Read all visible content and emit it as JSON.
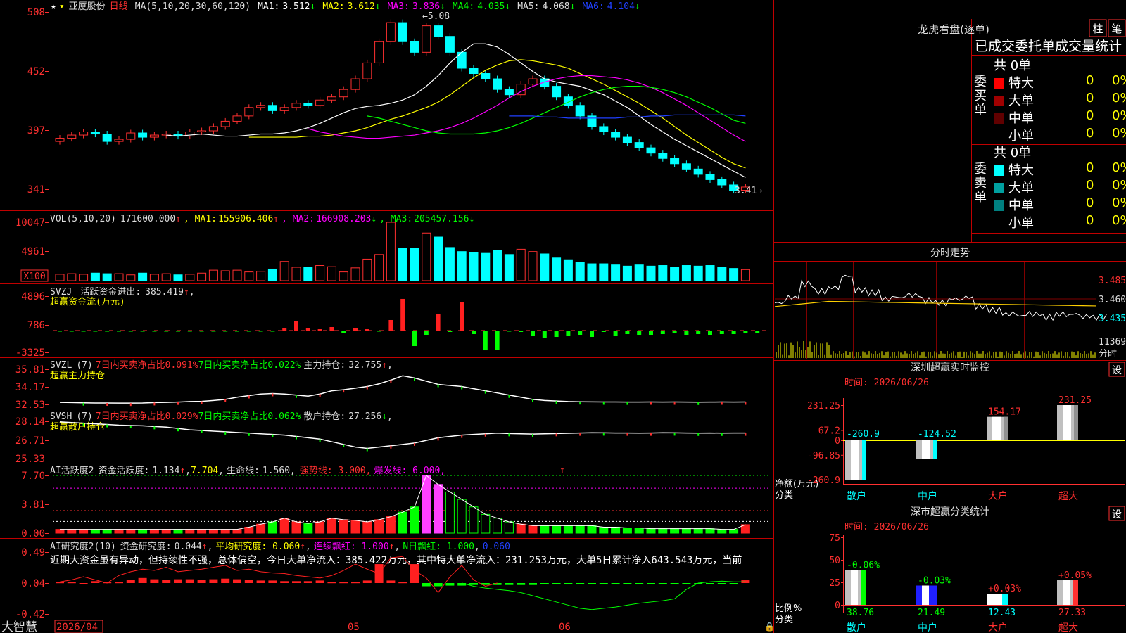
{
  "stock": {
    "name": "亚厦股份",
    "period": "日线"
  },
  "main_panel": {
    "ma_header": "MA(5,10,20,30,60,120)",
    "ma": [
      {
        "label": "MA1:",
        "value": "3.512",
        "arrow": "↓",
        "color": "#ffffff"
      },
      {
        "label": "MA2:",
        "value": "3.612",
        "arrow": "↓",
        "color": "#ffff00"
      },
      {
        "label": "MA3:",
        "value": "3.836",
        "arrow": "↓",
        "color": "#ff00ff"
      },
      {
        "label": "MA4:",
        "value": "4.035",
        "arrow": "↓",
        "color": "#00ff00"
      },
      {
        "label": "MA5:",
        "value": "4.068",
        "arrow": "↓",
        "color": "#dddddd"
      },
      {
        "label": "MA6:",
        "value": "4.104",
        "arrow": "↓",
        "color": "#2040ff"
      }
    ],
    "y_ticks": [
      "508",
      "452",
      "397",
      "341"
    ],
    "high_label": "5.08",
    "low_label": "3.41"
  },
  "vol_panel": {
    "header": "VOL(5,10,20)",
    "value": "171600.000",
    "ma": [
      {
        "label": "MA1:",
        "value": "155906.406",
        "arrow": "↑",
        "color": "#ffff00"
      },
      {
        "label": "MA2:",
        "value": "166908.203",
        "arrow": "↓",
        "color": "#ff00ff"
      },
      {
        "label": "MA3:",
        "value": "205457.156",
        "arrow": "↓",
        "color": "#00ff00"
      }
    ],
    "y_ticks": [
      "10047",
      "4961"
    ],
    "unit": "X100"
  },
  "svzj_panel": {
    "line1_a": "SVZJ",
    "line1_b": "活跃资金进出:",
    "line1_value": "385.419",
    "line1_arrow": "↑",
    "line2": "超赢资金流(万元)",
    "y_ticks": [
      "4896",
      "786",
      "-3325"
    ]
  },
  "svzl_panel": {
    "name": "SVZL",
    "param": "(7)",
    "t1": "7日内买卖净占比0.091%",
    "t2": "7日内买卖净占比0.022%",
    "label": "主力持仓:",
    "value": "32.755",
    "arrow": "↑",
    "line2": "超赢主力持仓",
    "y_ticks": [
      "35.81",
      "34.17",
      "32.53"
    ]
  },
  "svsh_panel": {
    "name": "SVSH",
    "param": "(7)",
    "t1": "7日内买卖净占比0.029%",
    "t2": "7日内买卖净占比0.062%",
    "label": "散户持仓:",
    "value": "27.256",
    "arrow": "↓",
    "line2": "超赢散户持仓",
    "y_ticks": [
      "28.14",
      "26.71",
      "25.33"
    ]
  },
  "ai_active_panel": {
    "title": "AI活跃度2",
    "a_label": "资金活跃度:",
    "a_value": "1.134",
    "a_arrow": "↑",
    "b_value": "7.704",
    "c_label": "生命线:",
    "c_value": "1.560",
    "d_text": "强势线: 3.000",
    "e_text": "爆发线: 6.000",
    "y_ticks": [
      "7.70",
      "3.81",
      "0.00"
    ]
  },
  "ai_research_panel": {
    "title": "AI研究度2(10)",
    "a_label": "资金研究度:",
    "a_value": "0.044",
    "a_arrow": "↑",
    "b_text": "平均研究度: 0.060",
    "b_arrow": "↑",
    "c_text": "连续飘红: 1.000",
    "c_arrow": "↑",
    "d_text": "N日飘红: 1.000",
    "e_text": "0.060",
    "commentary": "近期大资金虽有异动，但持续性不强，总体偏空，今日大单净流入：385.422万元，其中特大单净流入：231.253万元，大单5日累计净入643.543万元，当前",
    "y_ticks": [
      "0.49",
      "0.04",
      "-0.42"
    ]
  },
  "x_axis": {
    "brand": "大智慧",
    "labels": [
      "2026/04",
      "05",
      "06"
    ]
  },
  "lhk": {
    "title": "龙虎看盘(逐单)",
    "btn1": "柱",
    "btn2": "笔",
    "subtitle": "已成交委托单成交量统计",
    "buy": {
      "side": "委买单",
      "total": "共 0单",
      "rows": [
        {
          "label": "特大",
          "n": "0",
          "p": "0%",
          "color": "#ff0000"
        },
        {
          "label": "大单",
          "n": "0",
          "p": "0%",
          "color": "#a00000"
        },
        {
          "label": "中单",
          "n": "0",
          "p": "0%",
          "color": "#600000"
        },
        {
          "label": "小单",
          "n": "0",
          "p": "0%",
          "color": "#000000"
        }
      ]
    },
    "sell": {
      "side": "委卖单",
      "total": "共 0单",
      "rows": [
        {
          "label": "特大",
          "n": "0",
          "p": "0%",
          "color": "#00ffff"
        },
        {
          "label": "大单",
          "n": "0",
          "p": "0%",
          "color": "#00a0a0"
        },
        {
          "label": "中单",
          "n": "0",
          "p": "0%",
          "color": "#008080"
        },
        {
          "label": "小单",
          "n": "0",
          "p": "0%",
          "color": "#000000"
        }
      ]
    }
  },
  "intraday": {
    "title": "分时走势",
    "y_ticks": [
      "3.485",
      "3.460",
      "3.435"
    ],
    "vol_label": "11369",
    "x_label": "分时"
  },
  "sz_monitor": {
    "title": "深圳超赢实时监控",
    "btn": "设",
    "time": "时间: 2026/06/26",
    "y_ticks": [
      "231.25",
      "67.2",
      "0",
      "-96.85",
      "-260.9"
    ],
    "axis_label1": "净额(万元)",
    "axis_label2": "分类"
  },
  "sz_class": {
    "title": "深市超赢分类统计",
    "btn": "设",
    "time": "时间: 2026/06/26",
    "y_ticks": [
      "75",
      "50",
      "25",
      "0"
    ],
    "axis_label1": "比例%",
    "axis_label2": "分类"
  },
  "chart_data": [
    {
      "type": "candlestick",
      "title": "亚厦股份 日线",
      "ylim": [
        3.41,
        5.08
      ],
      "high": 5.08,
      "low": 3.41,
      "note": "prices in yuan; y tick labels shown ×100",
      "x": [
        "2026/04",
        "05",
        "06"
      ],
      "series": [
        {
          "name": "K线",
          "values": [
            3.89,
            3.92,
            3.95,
            3.93,
            3.86,
            3.88,
            3.94,
            3.9,
            3.92,
            3.93,
            3.91,
            3.95,
            3.96,
            4.0,
            4.05,
            4.1,
            4.18,
            4.2,
            4.15,
            4.18,
            4.22,
            4.2,
            4.25,
            4.28,
            4.35,
            4.45,
            4.6,
            4.8,
            4.98,
            4.8,
            4.7,
            4.95,
            4.85,
            4.7,
            4.55,
            4.5,
            4.45,
            4.35,
            4.3,
            4.4,
            4.45,
            4.38,
            4.28,
            4.2,
            4.1,
            4.0,
            3.95,
            3.9,
            3.85,
            3.8,
            3.75,
            3.7,
            3.65,
            3.6,
            3.55,
            3.5,
            3.45,
            3.4,
            3.43
          ]
        },
        {
          "name": "MA1",
          "values": [
            3.92,
            3.91,
            3.92,
            3.93,
            3.92,
            3.91,
            3.91,
            3.92,
            3.93,
            3.93,
            3.94,
            3.96,
            3.99,
            4.03,
            4.08,
            4.13,
            4.17,
            4.19,
            4.2,
            4.22,
            4.25,
            4.3,
            4.38,
            4.48,
            4.6,
            4.7,
            4.78,
            4.78,
            4.75,
            4.68,
            4.6,
            4.52,
            4.45,
            4.42,
            4.4,
            4.38,
            4.34,
            4.3,
            4.24,
            4.18,
            4.1,
            4.02,
            3.95,
            3.88,
            3.82,
            3.76,
            3.7,
            3.64,
            3.58,
            3.52
          ]
        },
        {
          "name": "MA2",
          "values": [
            3.9,
            3.9,
            3.9,
            3.9,
            3.9,
            3.91,
            3.91,
            3.92,
            3.94,
            3.96,
            3.99,
            4.03,
            4.07,
            4.1,
            4.14,
            4.18,
            4.23,
            4.3,
            4.38,
            4.46,
            4.53,
            4.58,
            4.62,
            4.63,
            4.62,
            4.6,
            4.58,
            4.55,
            4.5,
            4.45,
            4.4,
            4.34,
            4.28,
            4.22,
            4.15,
            4.08,
            4.0,
            3.92,
            3.85,
            3.78,
            3.71,
            3.65,
            3.61
          ]
        },
        {
          "name": "MA3",
          "values": [
            3.98,
            3.95,
            3.93,
            3.91,
            3.9,
            3.89,
            3.89,
            3.9,
            3.91,
            3.92,
            3.94,
            3.96,
            3.99,
            4.03,
            4.08,
            4.14,
            4.2,
            4.27,
            4.33,
            4.38,
            4.42,
            4.45,
            4.47,
            4.48,
            4.48,
            4.47,
            4.46,
            4.44,
            4.41,
            4.37,
            4.32,
            4.26,
            4.2,
            4.13,
            4.06,
            3.99,
            3.92,
            3.86
          ]
        },
        {
          "name": "MA4",
          "values": [
            4.1,
            4.08,
            4.05,
            4.02,
            3.99,
            3.96,
            3.94,
            3.93,
            3.93,
            3.93,
            3.94,
            3.96,
            3.99,
            4.03,
            4.08,
            4.13,
            4.18,
            4.23,
            4.28,
            4.32,
            4.35,
            4.37,
            4.38,
            4.38,
            4.37,
            4.35,
            4.32,
            4.28,
            4.23,
            4.18,
            4.12,
            4.06,
            4.03
          ]
        },
        {
          "name": "MA6",
          "values": [
            4.1,
            4.1,
            4.1,
            4.09,
            4.09,
            4.08,
            4.08,
            4.08,
            4.08,
            4.08,
            4.09,
            4.09,
            4.1,
            4.1,
            4.11,
            4.11,
            4.11,
            4.11,
            4.11,
            4.11,
            4.1
          ]
        }
      ]
    },
    {
      "type": "bar",
      "title": "VOL(5,10,20)",
      "ylim": [
        0,
        10047
      ],
      "series": [
        {
          "name": "VOL",
          "values": [
            1100,
            1200,
            1100,
            1300,
            1200,
            1200,
            1000,
            1300,
            1100,
            1200,
            1000,
            1100,
            1300,
            1800,
            1700,
            1800,
            1500,
            1600,
            2000,
            3300,
            2300,
            2300,
            2600,
            2400,
            1500,
            2200,
            3700,
            4500,
            10047,
            5600,
            5600,
            8200,
            7500,
            5700,
            5000,
            4800,
            4700,
            5200,
            4500,
            5400,
            5000,
            4600,
            3900,
            3600,
            3100,
            2900,
            2900,
            2700,
            2500,
            2700,
            2500,
            2600,
            2300,
            2600,
            2500,
            2600,
            2300,
            2100,
            1900
          ]
        }
      ]
    },
    {
      "type": "bar",
      "title": "SVZJ 超赢资金流(万元)",
      "ylim": [
        -3325,
        4896
      ],
      "series": [
        {
          "name": "SVZJ",
          "values": [
            -20,
            -50,
            -50,
            -40,
            -60,
            -30,
            -40,
            -50,
            -60,
            -30,
            -50,
            -60,
            -40,
            -30,
            -30,
            -40,
            -50,
            -30,
            -30,
            400,
            1300,
            300,
            200,
            500,
            -300,
            400,
            200,
            -100,
            1500,
            4500,
            -2200,
            -700,
            2300,
            -200,
            4000,
            -500,
            -2800,
            -2700,
            -100,
            -200,
            -800,
            -1000,
            -900,
            -800,
            -600,
            -900,
            -200,
            -800,
            -500,
            -700,
            -600,
            -500,
            -400,
            -600,
            -500,
            -600,
            -500,
            -500,
            -400,
            -300
          ]
        }
      ]
    },
    {
      "type": "line",
      "title": "SVZL 超赢主力持仓",
      "ylim": [
        32.53,
        35.81
      ],
      "series": [
        {
          "name": "主力持仓",
          "values": [
            32.72,
            32.7,
            32.68,
            32.66,
            32.66,
            32.65,
            32.65,
            32.66,
            32.7,
            32.72,
            32.75,
            32.8,
            32.82,
            32.9,
            33.0,
            33.2,
            33.35,
            33.5,
            33.55,
            33.5,
            33.4,
            33.3,
            33.5,
            33.8,
            33.9,
            34.05,
            34.2,
            34.45,
            34.8,
            35.2,
            35.0,
            34.7,
            34.4,
            34.3,
            34.2,
            34.0,
            33.8,
            33.6,
            33.4,
            33.2,
            33.0,
            32.9,
            32.85,
            32.8,
            32.78,
            32.77,
            32.76,
            32.76,
            32.75,
            32.75,
            32.76,
            32.75,
            32.76,
            32.75,
            32.74,
            32.75,
            32.76,
            32.75,
            32.76
          ]
        }
      ]
    },
    {
      "type": "line",
      "title": "SVSH 超赢散户持仓",
      "ylim": [
        25.33,
        28.14
      ],
      "series": [
        {
          "name": "散户持仓",
          "values": [
            28.1,
            28.05,
            28.0,
            27.95,
            27.9,
            27.85,
            27.82,
            27.8,
            27.75,
            27.7,
            27.6,
            27.5,
            27.45,
            27.4,
            27.35,
            27.3,
            27.25,
            27.2,
            27.15,
            27.1,
            27.0,
            26.9,
            26.8,
            26.6,
            26.4,
            26.2,
            26.1,
            26.2,
            26.3,
            26.4,
            26.5,
            26.7,
            26.9,
            27.0,
            27.1,
            27.15,
            27.2,
            27.25,
            27.22,
            27.2,
            27.18,
            27.2,
            27.22,
            27.24,
            27.26,
            27.28,
            27.27,
            27.26,
            27.26,
            27.25,
            27.26,
            27.28,
            27.27,
            27.26,
            27.25,
            27.26,
            27.25,
            27.26,
            27.26
          ]
        }
      ]
    },
    {
      "type": "bar",
      "title": "AI活跃度2",
      "ylim": [
        0,
        7.7
      ],
      "series": [
        {
          "name": "资金活跃度",
          "values": [
            0.5,
            0.5,
            0.5,
            0.5,
            0.5,
            0.5,
            0.5,
            0.5,
            0.5,
            0.5,
            0.5,
            0.5,
            0.5,
            0.5,
            0.5,
            0.5,
            0.8,
            1.2,
            1.5,
            2.0,
            1.5,
            1.3,
            1.5,
            2.0,
            1.8,
            1.7,
            1.5,
            1.8,
            2.2,
            2.8,
            3.5,
            7.7,
            6.5,
            5.5,
            4.5,
            3.5,
            2.5,
            2.0,
            1.5,
            1.2,
            1.0,
            1.0,
            1.0,
            1.0,
            1.0,
            1.0,
            0.8,
            0.8,
            0.7,
            0.7,
            0.6,
            0.6,
            0.6,
            0.6,
            0.6,
            0.6,
            0.5,
            0.5,
            1.134
          ]
        }
      ]
    },
    {
      "type": "bar",
      "title": "AI研究度2(10)",
      "ylim": [
        -0.42,
        0.49
      ],
      "series": [
        {
          "name": "资金研究度",
          "values": [
            0.02,
            0.02,
            0.0,
            0.03,
            0.02,
            0.02,
            0.05,
            0.08,
            0.06,
            0.05,
            0.06,
            0.06,
            0.05,
            0.06,
            0.07,
            0.06,
            0.05,
            0.04,
            0.04,
            0.03,
            0.03,
            0.03,
            0.04,
            0.02,
            0.02,
            0.02,
            0.04,
            0.3,
            0.04,
            0.02,
            0.3,
            -0.05,
            -0.05,
            -0.04,
            -0.04,
            -0.03,
            -0.03,
            -0.03,
            -0.03,
            -0.03,
            -0.03,
            -0.02,
            -0.02,
            -0.02,
            -0.02,
            -0.02,
            -0.02,
            -0.02,
            -0.02,
            -0.02,
            -0.02,
            -0.02,
            -0.02,
            -0.02,
            -0.02,
            -0.02,
            -0.02,
            -0.02,
            0.044
          ]
        }
      ]
    },
    {
      "type": "line",
      "title": "分时走势",
      "ylim": [
        3.435,
        3.485
      ],
      "series": [
        {
          "name": "价格",
          "values": [
            3.455,
            3.462,
            3.48,
            3.47,
            3.475,
            3.49,
            3.472,
            3.468,
            3.46,
            3.462,
            3.465,
            3.458,
            3.455,
            3.46,
            3.462,
            3.45,
            3.445,
            3.44,
            3.438,
            3.44,
            3.436,
            3.44,
            3.44,
            3.437,
            3.436
          ]
        }
      ]
    },
    {
      "type": "bar",
      "title": "深圳超赢实时监控",
      "ylim": [
        -260.9,
        231.25
      ],
      "categories": [
        "散户",
        "中户",
        "大户",
        "超大"
      ],
      "series": [
        {
          "name": "净额(万元)",
          "values": [
            -260.9,
            -124.52,
            154.17,
            231.25
          ]
        }
      ]
    },
    {
      "type": "bar",
      "title": "深市超赢分类统计",
      "ylim": [
        0,
        75
      ],
      "categories": [
        "散户",
        "中户",
        "大户",
        "超大"
      ],
      "series": [
        {
          "name": "比例%",
          "values": [
            38.76,
            21.49,
            12.43,
            27.33
          ]
        },
        {
          "name": "变化",
          "values": [
            -0.06,
            -0.03,
            0.03,
            0.05
          ]
        }
      ],
      "bar_labels": [
        "-0.06%",
        "-0.03%",
        "+0.03%",
        "+0.05%"
      ]
    }
  ]
}
